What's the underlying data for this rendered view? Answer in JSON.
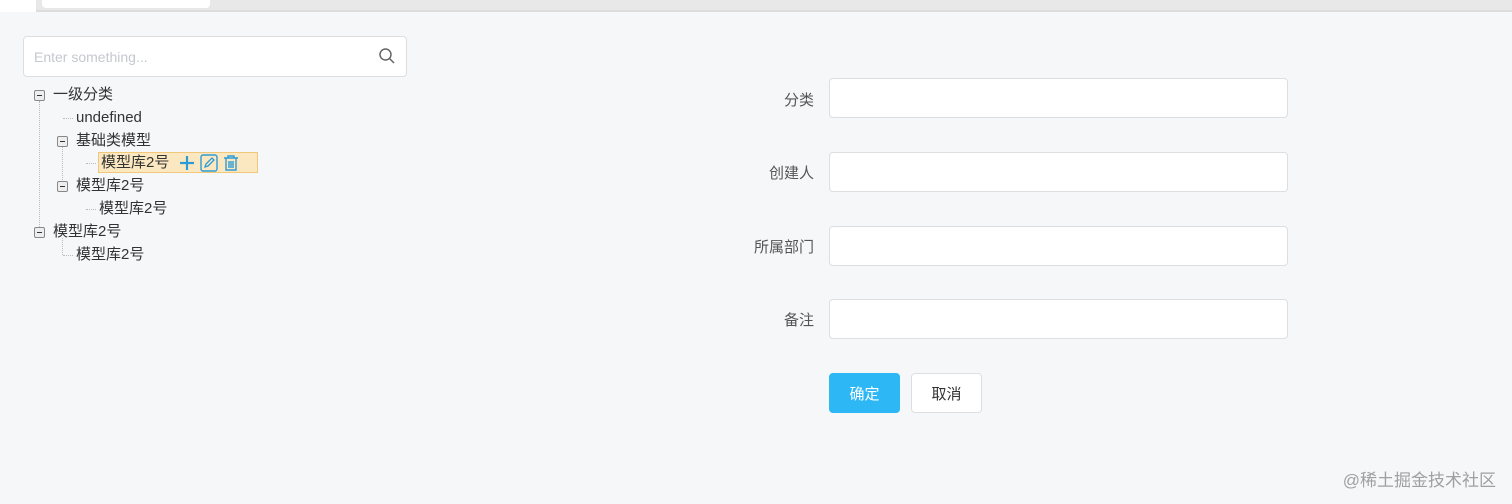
{
  "search": {
    "placeholder": "Enter something..."
  },
  "tree": {
    "root1": "一级分类",
    "undef": "undefined",
    "basic": "基础类模型",
    "basic_child": "模型库2号",
    "lib": "模型库2号",
    "lib_child": "模型库2号",
    "root2": "模型库2号",
    "root2_child": "模型库2号"
  },
  "form": {
    "category": "分类",
    "creator": "创建人",
    "department": "所属部门",
    "remark": "备注",
    "category_value": "",
    "creator_value": "",
    "department_value": "",
    "remark_value": ""
  },
  "buttons": {
    "ok": "确定",
    "cancel": "取消"
  },
  "watermark": "@稀土掘金技术社区",
  "colors": {
    "primary": "#2db7f5",
    "icon": "#2d9bd6"
  }
}
